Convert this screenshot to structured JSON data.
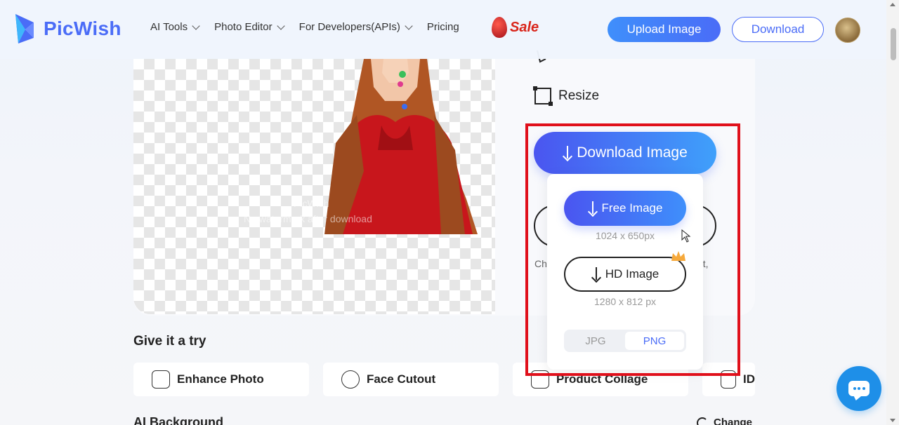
{
  "header": {
    "brand": "PicWish",
    "nav": [
      {
        "label": "AI Tools",
        "dropdown": true
      },
      {
        "label": "Photo Editor",
        "dropdown": true
      },
      {
        "label": "For Developers(APIs)",
        "dropdown": true
      },
      {
        "label": "Pricing",
        "dropdown": false
      }
    ],
    "sale_label": "Sale",
    "upload_label": "Upload Image",
    "download_label": "Download"
  },
  "canvas": {
    "watermark_brand": "PicWish",
    "watermark_note": "No watermark after download"
  },
  "panel": {
    "resize_label": "Resize",
    "partial_left": "Ch",
    "partial_right": "ext,"
  },
  "download": {
    "main_label": "Download Image",
    "free_label": "Free Image",
    "free_size": "1024 x 650px",
    "hd_label": "HD Image",
    "hd_size": "1280 x 812 px",
    "formats": [
      "JPG",
      "PNG"
    ],
    "selected_format": "PNG"
  },
  "try": {
    "title": "Give it a try",
    "tools": [
      "Enhance Photo",
      "Face Cutout",
      "Product Collage",
      "ID"
    ]
  },
  "ai_background": {
    "title": "AI Background",
    "change_label": "Change"
  },
  "colors": {
    "brand": "#4a6cf7",
    "highlight": "#e0101b",
    "chat": "#1e8fe8"
  }
}
